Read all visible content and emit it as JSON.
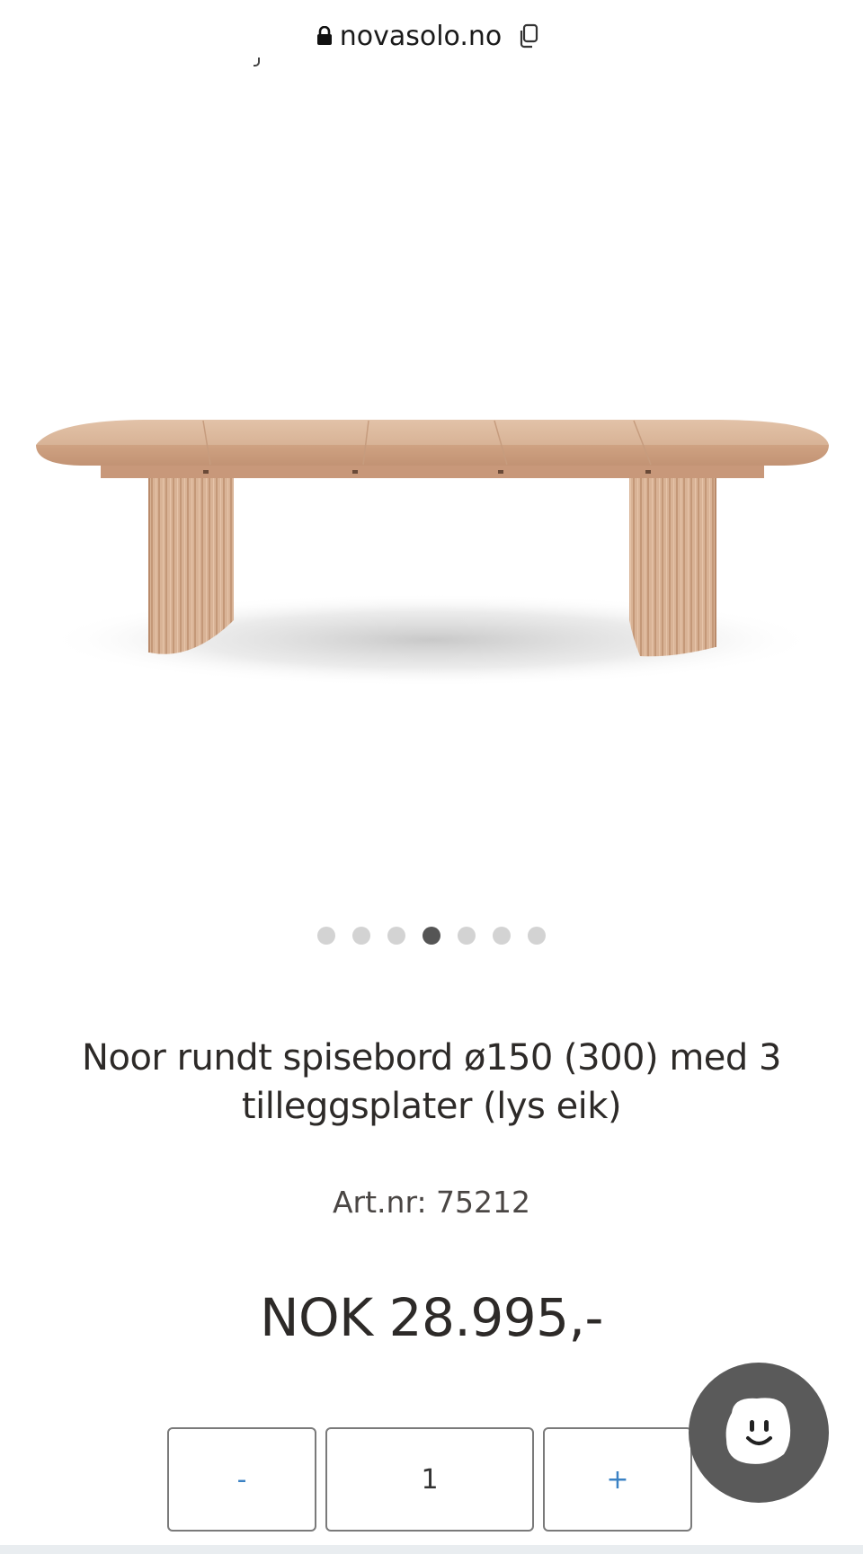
{
  "browser": {
    "domain": "novasolo.no",
    "lock_icon": "lock-icon",
    "copy_icon": "copy-icon"
  },
  "gallery": {
    "image_alt": "Noor rundt spisebord med tilleggsplater i lys eik",
    "slide_count": 7,
    "active_slide": 4
  },
  "product": {
    "title": "Noor rundt spisebord ø150 (300) med 3 tilleggsplater (lys eik)",
    "art_nr": "Art.nr: 75212",
    "price": "NOK 28.995,-"
  },
  "quantity": {
    "decrease_label": "-",
    "value": "1",
    "increase_label": "+"
  },
  "colors": {
    "accent": "#3b82c4",
    "text": "#2d2a28",
    "dot_inactive": "#d3d3d3",
    "dot_active": "#555555",
    "chat_bg": "#5a5a5a"
  },
  "chat": {
    "icon": "chat-smiley-icon"
  }
}
